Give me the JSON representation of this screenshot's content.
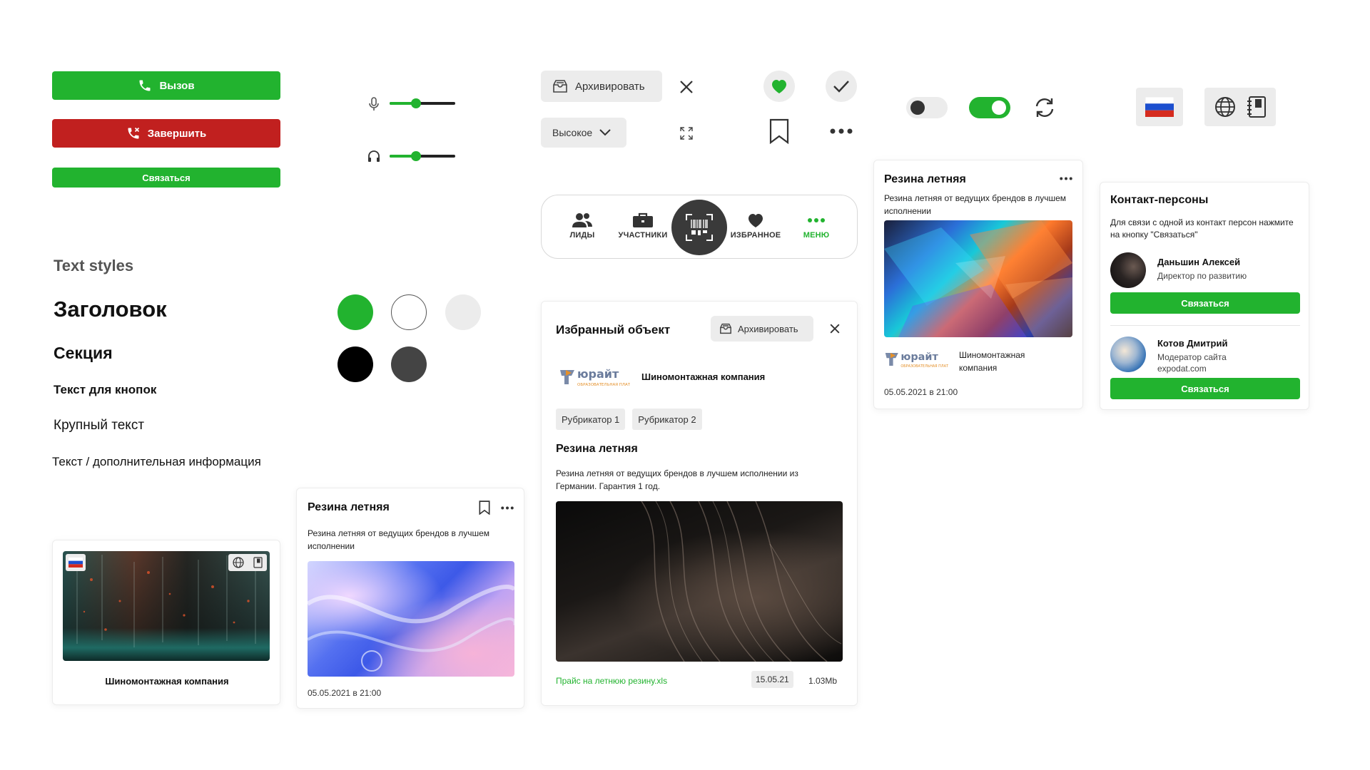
{
  "colors": {
    "green": "#22b32f",
    "red": "#c1201f",
    "dark": "#444444",
    "light_gray": "#ececec"
  },
  "call_buttons": {
    "call_label": "Вызов",
    "end_label": "Завершить",
    "contact_label": "Связаться"
  },
  "volume": {
    "mic_level": 0.4,
    "headphone_level": 0.4
  },
  "controls": {
    "archive_label": "Архивировать",
    "priority_value": "Высокое"
  },
  "toggles": {
    "toggle_off": false,
    "toggle_on": true
  },
  "bottom_nav": {
    "items": [
      {
        "label": "ЛИДЫ",
        "icon": "users-icon"
      },
      {
        "label": "УЧАСТНИКИ",
        "icon": "briefcase-icon"
      },
      {
        "label": "ИЗБРАННОЕ",
        "icon": "heart-icon"
      },
      {
        "label": "МЕНЮ",
        "icon": "more-icon"
      }
    ],
    "center_icon": "barcode-scan-icon"
  },
  "text_styles": {
    "section_title": "Text styles",
    "heading": "Заголовок",
    "section": "Секция",
    "button_text": "Текст для кнопок",
    "large_text": "Крупный текст",
    "secondary_text": "Текст / дополнительная информация"
  },
  "swatches": [
    "#22b32f",
    "#ffffff",
    "#ececec",
    "#000000",
    "#444444"
  ],
  "card_small": {
    "company": "Шиномонтажная компания"
  },
  "card_post": {
    "title": "Резина летняя",
    "description": "Резина летняя от ведущих брендов в лучшем исполнении",
    "date": "05.05.2021 в 21:00"
  },
  "favorite_modal": {
    "title": "Избранный объект",
    "archive_label": "Архивировать",
    "company": "Шиномонтажная компания",
    "tags": [
      "Рубрикатор 1",
      "Рубрикатор 2"
    ],
    "post_title": "Резина летняя",
    "post_description": "Резина летняя от ведущих брендов в лучшем исполнении из Германии. Гарантия 1 год.",
    "file_name": "Прайс на летнюю резину.xls",
    "file_date": "15.05.21",
    "file_size": "1.03Mb"
  },
  "card_feed": {
    "title": "Резина летняя",
    "description": "Резина летняя от ведущих брендов в лучшем исполнении",
    "company": "Шиномонтажная компания",
    "date": "05.05.2021 в 21:00"
  },
  "contacts": {
    "title": "Контакт-персоны",
    "description": "Для связи с одной из контакт персон нажмите на кнопку \"Связаться\"",
    "people": [
      {
        "name": "Даньшин Алексей",
        "role": "Директор по развитию",
        "extra": "",
        "button": "Связаться"
      },
      {
        "name": "Котов Дмитрий",
        "role": "Модератор сайта",
        "extra": "expodat.com",
        "button": "Связаться"
      }
    ]
  },
  "logo": {
    "word": "юрайт",
    "tagline": "ОБРАЗОВАТЕЛЬНАЯ ПЛАТФОРМА"
  }
}
